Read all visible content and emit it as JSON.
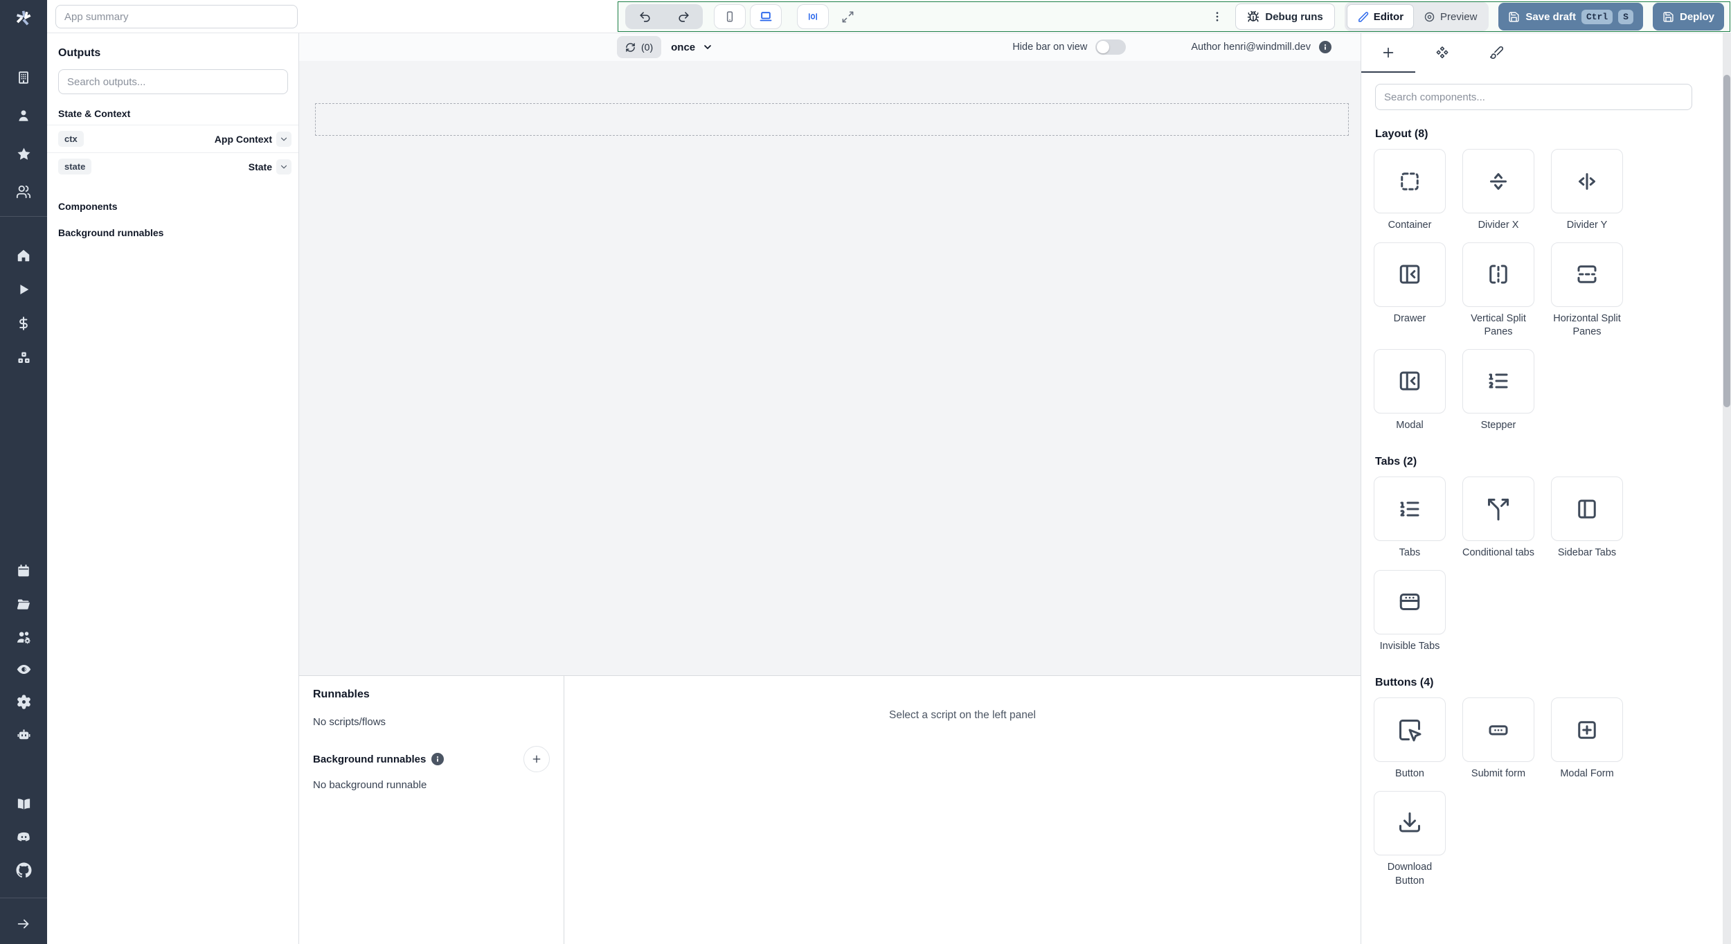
{
  "colors": {
    "sidebar_bg": "#2d3747",
    "accent_green_border": "#1c7f46",
    "primary_button_blue": "#5d7fa3",
    "device_accent_blue": "#2563eb",
    "canvas_bg": "#f3f4f6"
  },
  "header": {
    "app_summary_placeholder": "App summary",
    "debug_runs_label": "Debug runs",
    "editor_label": "Editor",
    "preview_label": "Preview",
    "save_draft_label": "Save draft",
    "kbd_ctrl": "Ctrl",
    "kbd_s": "S",
    "deploy_label": "Deploy"
  },
  "outputs": {
    "title": "Outputs",
    "search_placeholder": "Search outputs...",
    "state_context_title": "State & Context",
    "rows": [
      {
        "key": "ctx",
        "type": "App Context"
      },
      {
        "key": "state",
        "type": "State"
      }
    ],
    "components_title": "Components",
    "background_title": "Background runnables"
  },
  "canvas": {
    "refresh_count": "(0)",
    "mode": "once",
    "hide_bar_label": "Hide bar on view",
    "author_label": "Author henri@windmill.dev"
  },
  "runnables": {
    "title": "Runnables",
    "no_scripts": "No scripts/flows",
    "background_title": "Background runnables",
    "no_background": "No background runnable",
    "select_hint": "Select a script on the left panel"
  },
  "components": {
    "search_placeholder": "Search components...",
    "sections": [
      {
        "title": "Layout (8)",
        "items": [
          {
            "label": "Container",
            "icon": "container-icon"
          },
          {
            "label": "Divider X",
            "icon": "divider-x-icon"
          },
          {
            "label": "Divider Y",
            "icon": "divider-y-icon"
          },
          {
            "label": "Drawer",
            "icon": "drawer-icon"
          },
          {
            "label": "Vertical Split Panes",
            "icon": "vertical-split-icon"
          },
          {
            "label": "Horizontal Split Panes",
            "icon": "horizontal-split-icon"
          },
          {
            "label": "Modal",
            "icon": "modal-icon"
          },
          {
            "label": "Stepper",
            "icon": "stepper-icon"
          }
        ]
      },
      {
        "title": "Tabs (2)",
        "items": [
          {
            "label": "Tabs",
            "icon": "tabs-icon"
          },
          {
            "label": "Conditional tabs",
            "icon": "conditional-tabs-icon"
          },
          {
            "label": "Sidebar Tabs",
            "icon": "sidebar-tabs-icon"
          },
          {
            "label": "Invisible Tabs",
            "icon": "invisible-tabs-icon"
          }
        ]
      },
      {
        "title": "Buttons (4)",
        "items": [
          {
            "label": "Button",
            "icon": "button-icon"
          },
          {
            "label": "Submit form",
            "icon": "submit-form-icon"
          },
          {
            "label": "Modal Form",
            "icon": "modal-form-icon"
          },
          {
            "label": "Download Button",
            "icon": "download-icon"
          }
        ]
      }
    ]
  },
  "sidebar_icon_names": [
    "windmill-logo",
    "building",
    "user",
    "star",
    "users",
    "home",
    "play",
    "dollar",
    "boxes",
    "calendar",
    "folder-open",
    "users-cog",
    "eye",
    "settings",
    "bot",
    "book-open",
    "discord",
    "github",
    "arrow-right"
  ]
}
